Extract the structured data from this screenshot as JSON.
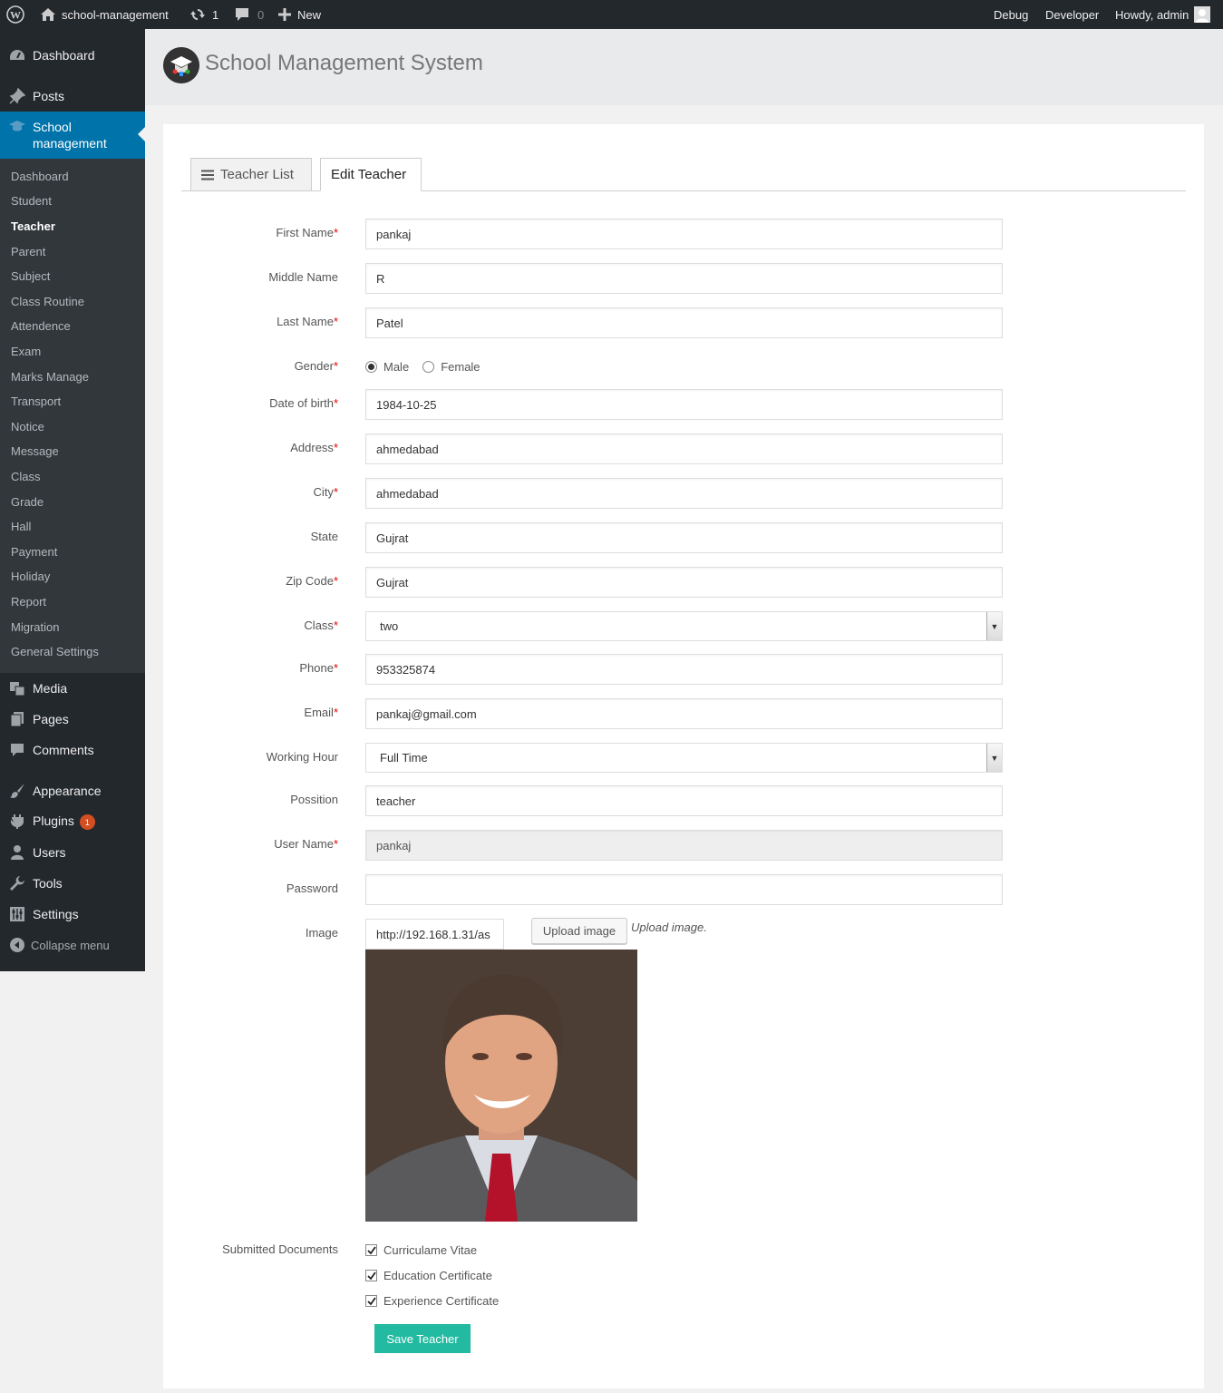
{
  "adminbar": {
    "site_name": "school-management",
    "updates_count": "1",
    "comments_count": "0",
    "new_label": "New",
    "debug_label": "Debug",
    "developer_label": "Developer",
    "howdy_label": "Howdy, admin"
  },
  "sidebar": {
    "dashboard": "Dashboard",
    "posts": "Posts",
    "school_management": "School management",
    "submenu": [
      "Dashboard",
      "Student",
      "Teacher",
      "Parent",
      "Subject",
      "Class Routine",
      "Attendence",
      "Exam",
      "Marks Manage",
      "Transport",
      "Notice",
      "Message",
      "Class",
      "Grade",
      "Hall",
      "Payment",
      "Holiday",
      "Report",
      "Migration",
      "General Settings"
    ],
    "current_submenu": "Teacher",
    "media": "Media",
    "pages": "Pages",
    "comments": "Comments",
    "appearance": "Appearance",
    "plugins": "Plugins",
    "plugins_badge": "1",
    "users": "Users",
    "tools": "Tools",
    "settings": "Settings",
    "collapse": "Collapse menu"
  },
  "header": {
    "title": "School Management System"
  },
  "tabs": {
    "list": "Teacher List",
    "edit": "Edit Teacher"
  },
  "form": {
    "first_name": {
      "label": "First Name",
      "value": "pankaj"
    },
    "middle_name": {
      "label": "Middle Name",
      "value": "R"
    },
    "last_name": {
      "label": "Last Name",
      "value": "Patel"
    },
    "gender": {
      "label": "Gender",
      "options": [
        "Male",
        "Female"
      ],
      "selected": "Male"
    },
    "dob": {
      "label": "Date of birth",
      "value": "1984-10-25"
    },
    "address": {
      "label": "Address",
      "value": "ahmedabad"
    },
    "city": {
      "label": "City",
      "value": "ahmedabad"
    },
    "state": {
      "label": "State",
      "value": "Gujrat"
    },
    "zip": {
      "label": "Zip Code",
      "value": "Gujrat"
    },
    "class": {
      "label": "Class",
      "value": "two"
    },
    "phone": {
      "label": "Phone",
      "value": "953325874"
    },
    "email": {
      "label": "Email",
      "value": "pankaj@gmail.com"
    },
    "working_hour": {
      "label": "Working Hour",
      "value": "Full Time"
    },
    "position": {
      "label": "Possition",
      "value": "teacher"
    },
    "username": {
      "label": "User Name",
      "value": "pankaj"
    },
    "password": {
      "label": "Password",
      "value": ""
    },
    "image": {
      "label": "Image",
      "value": "http://192.168.1.31/as",
      "upload_label": "Upload image",
      "hint": "Upload image."
    },
    "documents": {
      "label": "Submitted Documents",
      "items": [
        "Curriculame Vitae",
        "Education Certificate",
        "Experience Certificate"
      ]
    },
    "save_label": "Save Teacher",
    "required_marker": "*"
  },
  "colors": {
    "adminbar_bg": "#23282d",
    "menu_current": "#0073aa",
    "submenu_bg": "#32373c",
    "save_button": "#22baa0",
    "required": "#ee0000"
  }
}
